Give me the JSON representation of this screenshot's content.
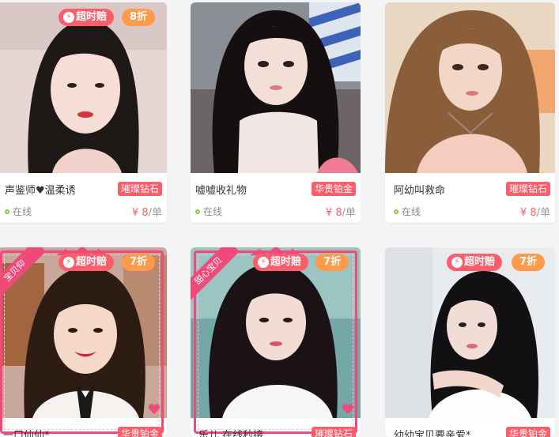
{
  "badges": {
    "timeout": "超时赔"
  },
  "cards": [
    {
      "name": "声鉴师♥温柔诱",
      "tier": "璀璨钻石",
      "status": "在线",
      "price": "¥ 8",
      "unit": "/单",
      "discount": "8折",
      "ribbon": ""
    },
    {
      "name": "嘘嘘收礼物",
      "tier": "华贵铂金",
      "status": "在线",
      "price": "¥ 8",
      "unit": "/单",
      "discount": "",
      "ribbon": ""
    },
    {
      "name": "阿幼叫救命",
      "tier": "璀璨钻石",
      "status": "在线",
      "price": "¥ 8",
      "unit": "/单",
      "discount": "",
      "ribbon": ""
    },
    {
      "name": "一口仙仙*",
      "tier": "华贵铂金",
      "status": "",
      "price": "",
      "unit": "",
      "discount": "7折",
      "ribbon": "宝贝仰"
    },
    {
      "name": "乐儿 在线秒接",
      "tier": "璀璨钻石",
      "status": "",
      "price": "",
      "unit": "",
      "discount": "7折",
      "ribbon": "甜心宝贝"
    },
    {
      "name": "幼幼宝贝要亲爱*",
      "tier": "华贵铂金",
      "status": "",
      "price": "",
      "unit": "",
      "discount": "7折",
      "ribbon": ""
    }
  ],
  "colors": {
    "accent": "#fb5e6a",
    "discount": "#ff9a4a",
    "online": "#8cc63f",
    "frame": "#f04a7a"
  },
  "icons": {
    "timeout": "lightning-icon",
    "online": "online-dot-icon",
    "frame_heart": "heart-icon"
  }
}
